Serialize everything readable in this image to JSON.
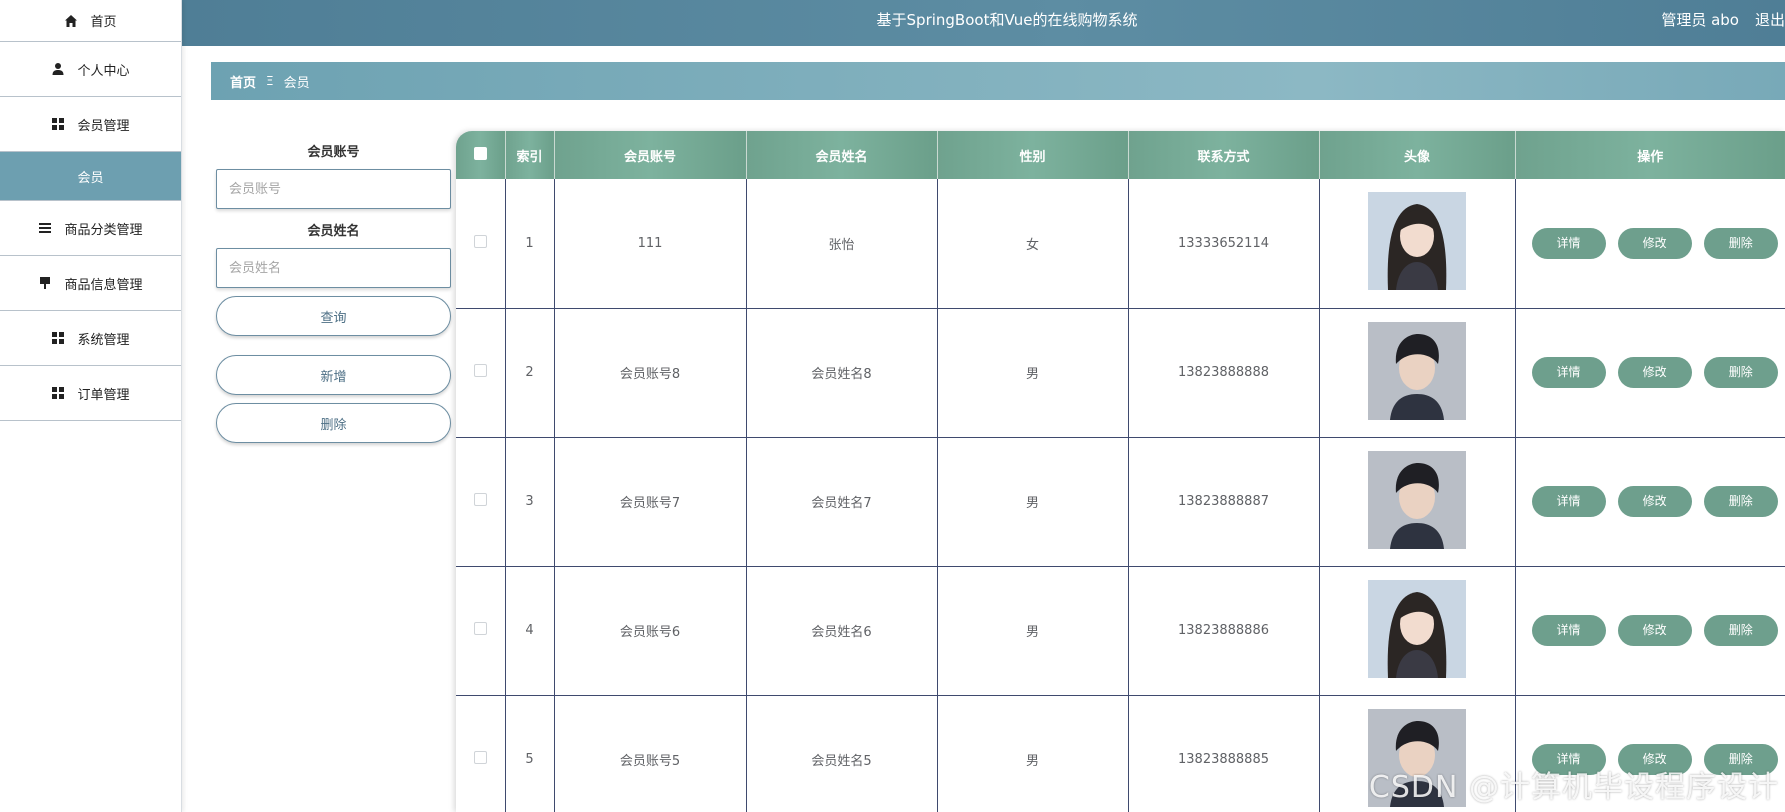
{
  "sidebar": {
    "items": [
      {
        "label": "首页",
        "icon": "home-icon"
      },
      {
        "label": "个人中心",
        "icon": "user-icon"
      },
      {
        "label": "会员管理",
        "icon": "grid-icon"
      },
      {
        "label": "会员",
        "icon": ""
      },
      {
        "label": "商品分类管理",
        "icon": "list-icon"
      },
      {
        "label": "商品信息管理",
        "icon": "pin-icon"
      },
      {
        "label": "系统管理",
        "icon": "grid-icon"
      },
      {
        "label": "订单管理",
        "icon": "grid-icon"
      }
    ],
    "active_color": "#6d9fb0"
  },
  "header": {
    "title": "基于SpringBoot和Vue的在线购物系统",
    "user": "管理员 abo",
    "logout": "退出"
  },
  "breadcrumb": {
    "home": "首页",
    "separator": "Ξ",
    "current": "会员"
  },
  "search": {
    "account_label": "会员账号",
    "account_placeholder": "会员账号",
    "name_label": "会员姓名",
    "name_placeholder": "会员姓名",
    "query_button": "查询",
    "add_button": "新增",
    "delete_button": "删除"
  },
  "table": {
    "columns": [
      "索引",
      "会员账号",
      "会员姓名",
      "性别",
      "联系方式",
      "头像",
      "操作"
    ],
    "actions": {
      "detail": "详情",
      "edit": "修改",
      "delete": "删除"
    },
    "rows": [
      {
        "index": "1",
        "account": "111",
        "name": "张怡",
        "gender": "女",
        "phone": "13333652114",
        "avatar": "avatar-female"
      },
      {
        "index": "2",
        "account": "会员账号8",
        "name": "会员姓名8",
        "gender": "男",
        "phone": "13823888888",
        "avatar": "avatar-male"
      },
      {
        "index": "3",
        "account": "会员账号7",
        "name": "会员姓名7",
        "gender": "男",
        "phone": "13823888887",
        "avatar": "avatar-male"
      },
      {
        "index": "4",
        "account": "会员账号6",
        "name": "会员姓名6",
        "gender": "男",
        "phone": "13823888886",
        "avatar": "avatar-female"
      },
      {
        "index": "5",
        "account": "会员账号5",
        "name": "会员姓名5",
        "gender": "男",
        "phone": "13823888885",
        "avatar": "avatar-male"
      }
    ],
    "header_color": "#76aa96",
    "button_color": "#6e9f8d"
  },
  "watermark": "CSDN @计算机毕设程序设计"
}
